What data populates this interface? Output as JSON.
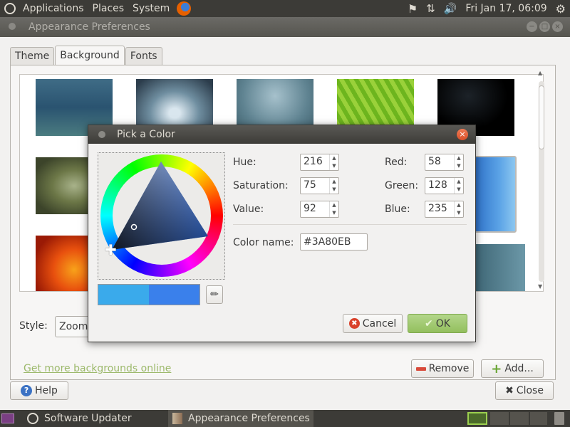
{
  "top_panel": {
    "menus": [
      "Applications",
      "Places",
      "System"
    ],
    "clock": "Fri Jan 17, 06:09"
  },
  "window": {
    "title": "Appearance Preferences",
    "tabs": [
      "Theme",
      "Background",
      "Fonts"
    ],
    "active_tab": "Background",
    "style_label": "Style:",
    "style_value": "Zoom",
    "link": "Get more backgrounds online",
    "remove_label": "Remove",
    "add_label": "Add...",
    "help_label": "Help",
    "close_label": "Close"
  },
  "dialog": {
    "title": "Pick a Color",
    "hue_label": "Hue:",
    "hue_value": "216",
    "saturation_label": "Saturation:",
    "saturation_value": "75",
    "value_label": "Value:",
    "value_value": "92",
    "red_label": "Red:",
    "red_value": "58",
    "green_label": "Green:",
    "green_value": "128",
    "blue_label": "Blue:",
    "blue_value": "235",
    "color_name_label": "Color name:",
    "color_name_value": "#3A80EB",
    "cancel_label": "Cancel",
    "ok_label": "OK",
    "previous_color": "#3aaaeb",
    "current_color": "#3a80eb"
  },
  "taskbar": {
    "items": [
      "Software Updater",
      "Appearance Preferences"
    ]
  },
  "colors": {
    "panel": "#3c3b37",
    "accent_green": "#93bf5e",
    "link": "#9cb96b"
  }
}
